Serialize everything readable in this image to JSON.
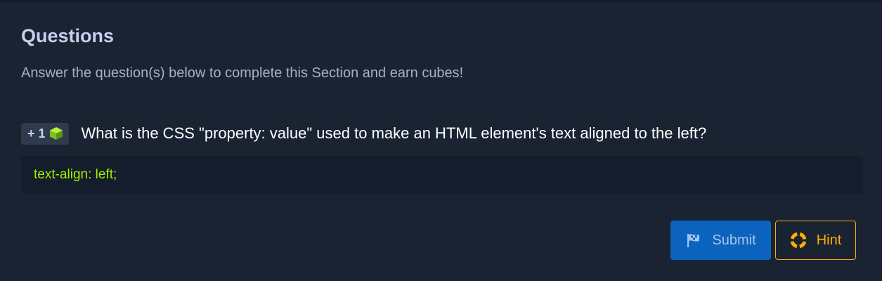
{
  "section": {
    "title": "Questions",
    "subtitle": "Answer the question(s) below to complete this Section and earn cubes!"
  },
  "question": {
    "reward": "+ 1",
    "reward_icon": "cube-icon",
    "text": "What is the CSS \"property: value\" used to make an HTML element's text aligned to the left?",
    "answer": "text-align: left;"
  },
  "actions": {
    "submit_label": "Submit",
    "submit_icon": "flag-icon",
    "hint_label": "Hint",
    "hint_icon": "lifebuoy-icon"
  },
  "colors": {
    "background": "#1a2332",
    "answer_text": "#9fef00",
    "submit_bg": "#0b63be",
    "hint_accent": "#ffaf00"
  }
}
